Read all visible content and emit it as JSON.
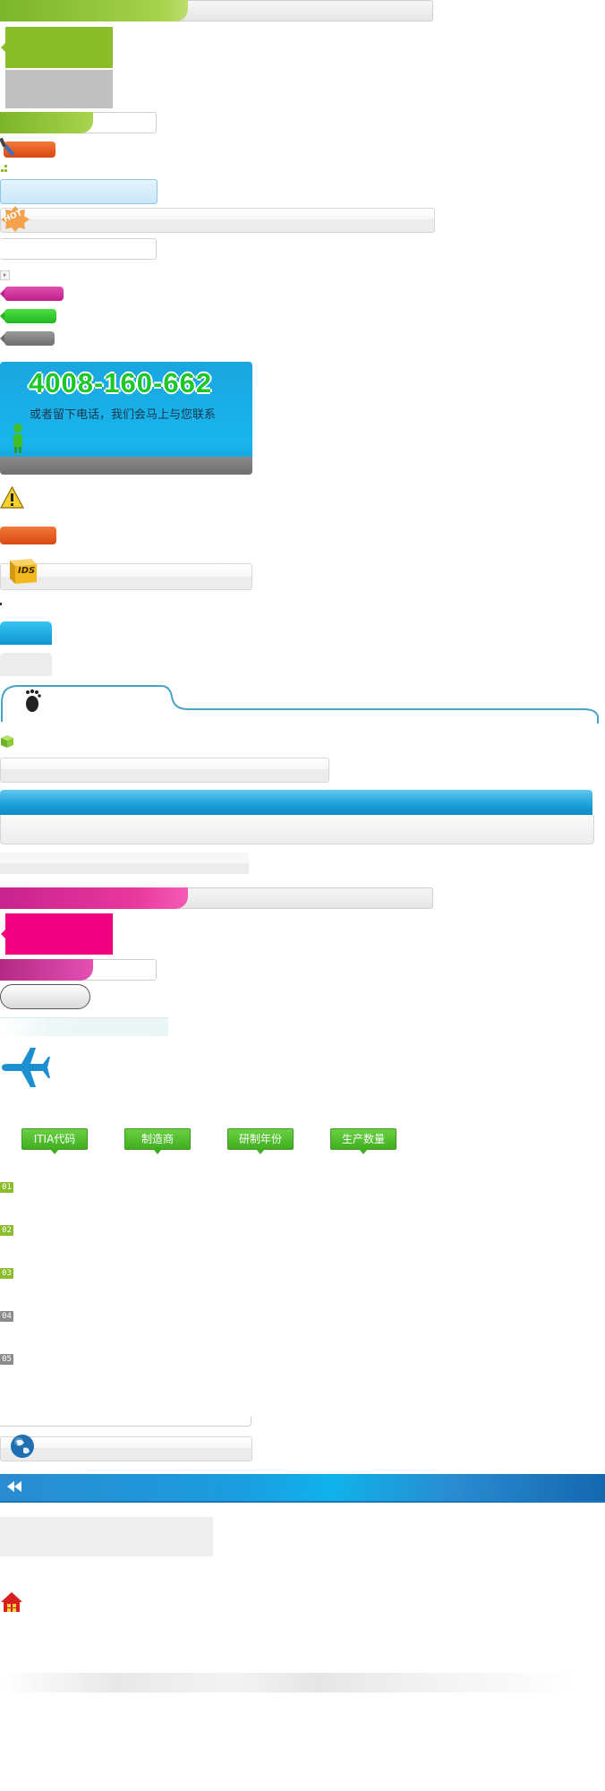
{
  "colors": {
    "green": "#8bbd2a",
    "gray": "#bdbdbd",
    "orange": "#e8561f",
    "pink": "#f0007e",
    "magenta": "#c8238e",
    "blue": "#14a5e3",
    "teal": "#49a3c4"
  },
  "hotline": {
    "number": "4008-160-662",
    "subtitle": "或者留下电话，我们会马上与您联系"
  },
  "badges": {
    "hot": "HOT",
    "ids": "IDS"
  },
  "table_tags": [
    "ITIA代码",
    "制造商",
    "研制年份",
    "生产数量"
  ],
  "rank_badges": [
    "01",
    "02",
    "03",
    "04",
    "05"
  ],
  "icons": {
    "phone_person": "person-icon",
    "warning": "warning-icon",
    "footprint": "footprint-icon",
    "cube": "cube-icon",
    "plane": "airplane-icon",
    "globe": "globe-icon",
    "rewind": "rewind-icon",
    "home": "home-icon"
  }
}
